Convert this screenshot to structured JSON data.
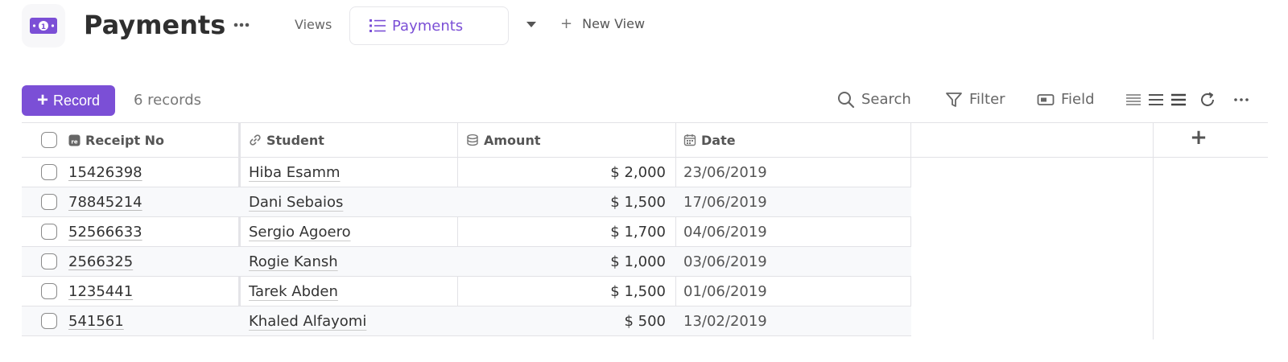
{
  "header": {
    "title": "Payments",
    "views_label": "Views",
    "active_view": "Payments",
    "new_view_label": "New View",
    "new_view_plus": "+"
  },
  "toolbar": {
    "record_plus": "+",
    "record_label": "Record",
    "record_count": "6 records",
    "search_label": "Search",
    "filter_label": "Filter",
    "field_label": "Field"
  },
  "table": {
    "columns": [
      {
        "label": "Receipt No",
        "icon": "text-field-icon"
      },
      {
        "label": "Student",
        "icon": "link-icon"
      },
      {
        "label": "Amount",
        "icon": "coins-icon"
      },
      {
        "label": "Date",
        "icon": "calendar-icon"
      }
    ],
    "rows": [
      {
        "receipt": "15426398",
        "student": "Hiba Esamm",
        "amount": "$ 2,000",
        "date": "23/06/2019"
      },
      {
        "receipt": "78845214",
        "student": "Dani Sebaios",
        "amount": "$ 1,500",
        "date": "17/06/2019"
      },
      {
        "receipt": "52566633",
        "student": "Sergio Agoero",
        "amount": "$ 1,700",
        "date": "04/06/2019"
      },
      {
        "receipt": "2566325",
        "student": "Rogie Kansh",
        "amount": "$ 1,000",
        "date": "03/06/2019"
      },
      {
        "receipt": "1235441",
        "student": "Tarek Abden",
        "amount": "$ 1,500",
        "date": "01/06/2019"
      },
      {
        "receipt": "541561",
        "student": "Khaled Alfayomi",
        "amount": "$ 500",
        "date": "13/02/2019"
      }
    ],
    "add_column": "+"
  },
  "colors": {
    "accent": "#7b4fd6",
    "border": "#e2e2e6",
    "row_alt": "#f8f9fb"
  }
}
